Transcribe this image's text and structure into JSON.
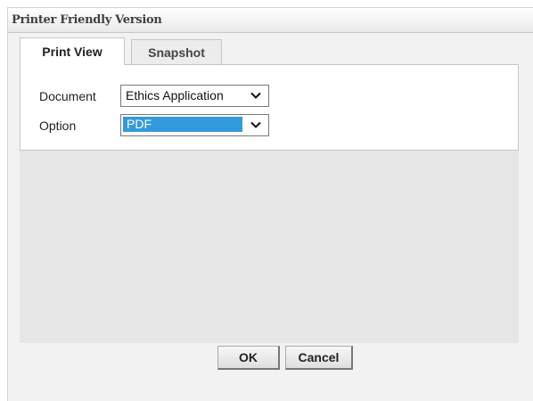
{
  "dialog": {
    "title": "Printer Friendly Version"
  },
  "tabs": [
    {
      "label": "Print View",
      "active": true
    },
    {
      "label": "Snapshot",
      "active": false
    }
  ],
  "form": {
    "document": {
      "label": "Document",
      "value": "Ethics Application"
    },
    "option": {
      "label": "Option",
      "value": "PDF",
      "highlight_color": "#3399dd"
    }
  },
  "buttons": {
    "ok": "OK",
    "cancel": "Cancel"
  },
  "icons": {
    "select_arrow": "chevron-down-icon"
  }
}
